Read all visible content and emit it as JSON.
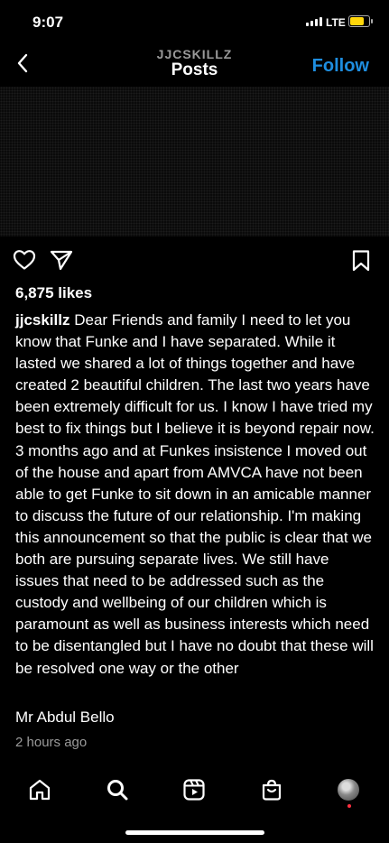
{
  "status_bar": {
    "time": "9:07",
    "network": "LTE",
    "battery_color": "#ffd60a"
  },
  "header": {
    "account": "JJCSKILLZ",
    "title": "Posts",
    "follow_label": "Follow",
    "follow_color": "#1e8ee0"
  },
  "post": {
    "likes": "6,875 likes",
    "username": "jjcskillz",
    "caption": "Dear Friends and family I need to let you know that Funke and I have separated. While it lasted  we shared a lot of things together and have created 2 beautiful children. The last two years have been extremely difficult for us. I know I have tried my best to fix things but I believe it is beyond repair now.  3 months ago  and at  Funkes insistence I moved out of the house and apart from AMVCA  have not been able to get Funke to sit down in an amicable manner to discuss the future of  our relationship. I'm making this announcement so that  the public is clear that we both are pursuing  separate lives. We still have issues that need to be addressed such as the custody and wellbeing of our children which is paramount as well as business interests which need to be disentangled but I have no doubt that these will be resolved one way or the other",
    "signature": "Mr Abdul Bello",
    "timestamp": "2 hours ago",
    "icons": {
      "like": "heart-icon",
      "share": "send-icon",
      "save": "bookmark-icon"
    }
  },
  "tab_bar": {
    "items": [
      "home-icon",
      "search-icon",
      "reels-icon",
      "shop-icon",
      "profile-avatar"
    ]
  }
}
